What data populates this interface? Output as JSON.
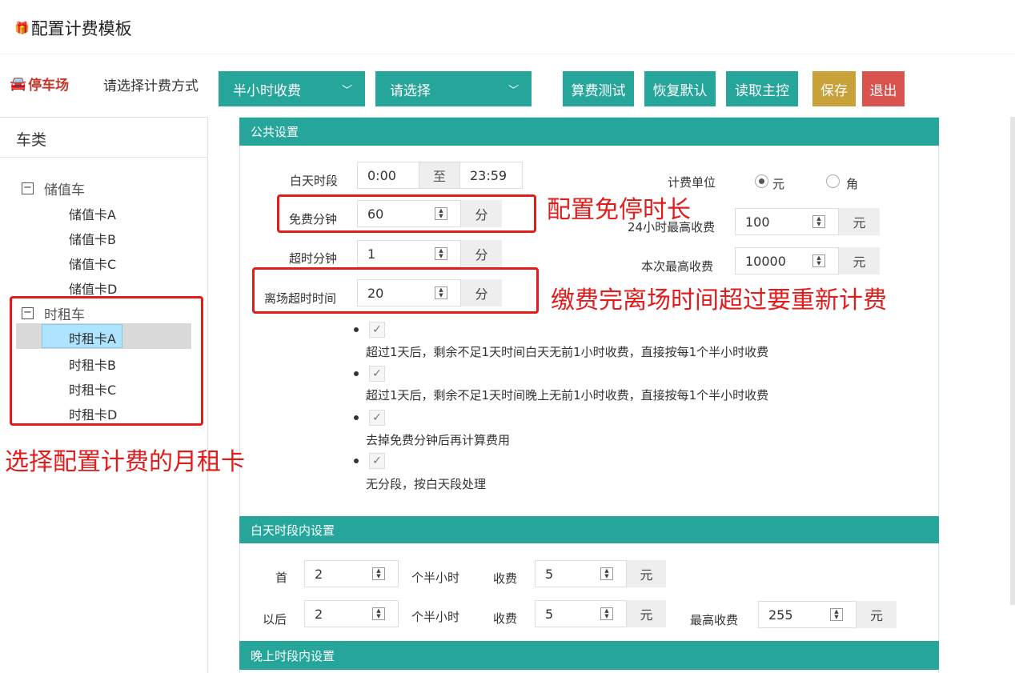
{
  "header": {
    "title": "配置计费模板",
    "gift_icon": "gift-icon"
  },
  "toolbar": {
    "lot_label": "停车场",
    "calc_method_label": "请选择计费方式",
    "method_select": "半小时收费",
    "second_select": "请选择",
    "btn_test": "算费测试",
    "btn_restore": "恢复默认",
    "btn_read": "读取主控",
    "btn_save": "保存",
    "btn_exit": "退出"
  },
  "sidebar": {
    "title": "车类",
    "groups": [
      {
        "label": "储值车",
        "toggle": "−",
        "items": [
          "储值卡A",
          "储值卡B",
          "储值卡C",
          "储值卡D"
        ]
      },
      {
        "label": "时租车",
        "toggle": "−",
        "items": [
          "时租卡A",
          "时租卡B",
          "时租卡C",
          "时租卡D"
        ]
      }
    ],
    "selected": "时租卡A"
  },
  "public": {
    "title": "公共设置",
    "day_period_label": "白天时段",
    "day_start": "0:00",
    "to_label": "至",
    "day_end": "23:59",
    "free_min_label": "免费分钟",
    "free_min": "60",
    "overtime_min_label": "超时分钟",
    "overtime_min": "1",
    "leave_overtime_label": "离场超时时间",
    "leave_overtime": "20",
    "minute_unit": "分",
    "billing_unit_label": "计费单位",
    "unit_yuan": "元",
    "unit_jiao": "角",
    "max24_label": "24小时最高收费",
    "max24": "100",
    "max_once_label": "本次最高收费",
    "max_once": "10000",
    "yuan_unit": "元",
    "options": [
      "超过1天后，剩余不足1天时间白天无前1小时收费，直接按每1个半小时收费",
      "超过1天后，剩余不足1天时间晚上无前1小时收费，直接按每1个半小时收费",
      "去掉免费分钟后再计算费用",
      "无分段，按白天段处理"
    ]
  },
  "day": {
    "title": "白天时段内设置",
    "first_label": "首",
    "first_count": "2",
    "after_label": "以后",
    "after_count": "2",
    "half_hour_label": "个半小时",
    "fee_label": "收费",
    "first_fee": "5",
    "after_fee": "5",
    "yuan": "元",
    "max_label": "最高收费",
    "max_fee": "255"
  },
  "night": {
    "title": "晚上时段内设置"
  },
  "annotations": {
    "free_time": "配置免停时长",
    "leave_time": "缴费完离场时间超过要重新计费",
    "select_card": "选择配置计费的月租卡"
  }
}
